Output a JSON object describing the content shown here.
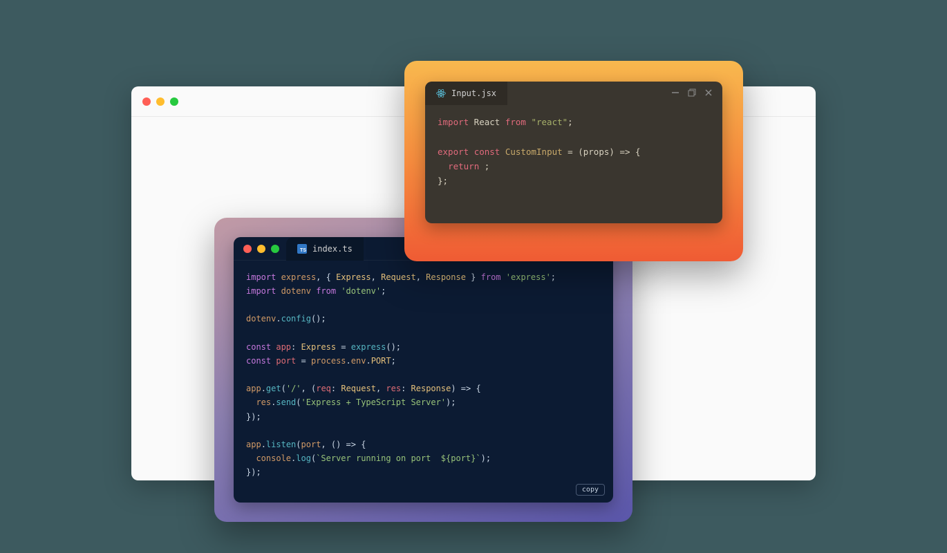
{
  "editor1": {
    "filename": "Input.jsx",
    "code_tokens": [
      [
        [
          "d1-kw",
          "import"
        ],
        [
          "d1-id",
          " React "
        ],
        [
          "d1-kw",
          "from"
        ],
        [
          "d1-id",
          " "
        ],
        [
          "d1-str",
          "\"react\""
        ],
        [
          "d1-id",
          ";"
        ]
      ],
      [],
      [
        [
          "d1-kw",
          "export"
        ],
        [
          "d1-id",
          " "
        ],
        [
          "d1-kw",
          "const"
        ],
        [
          "d1-id",
          " "
        ],
        [
          "d1-decl",
          "CustomInput"
        ],
        [
          "d1-id",
          " = (props) =&gt; {"
        ]
      ],
      [
        [
          "d1-id",
          "  "
        ],
        [
          "d1-kw",
          "return"
        ],
        [
          "d1-id",
          " ;"
        ]
      ],
      [
        [
          "d1-id",
          "};"
        ]
      ]
    ]
  },
  "editor2": {
    "filename": "index.ts",
    "copy_label": "copy",
    "code_tokens": [
      [
        [
          "d2-kw",
          "import"
        ],
        [
          "d2-plain",
          " "
        ],
        [
          "d2-id",
          "express"
        ],
        [
          "d2-plain",
          ", { "
        ],
        [
          "d2-type",
          "Express"
        ],
        [
          "d2-plain",
          ", "
        ],
        [
          "d2-type",
          "Request"
        ],
        [
          "d2-plain",
          ", "
        ],
        [
          "d2-type",
          "Response"
        ],
        [
          "d2-plain",
          " } "
        ],
        [
          "d2-kw",
          "from"
        ],
        [
          "d2-plain",
          " "
        ],
        [
          "d2-str",
          "'express'"
        ],
        [
          "d2-plain",
          ";"
        ]
      ],
      [
        [
          "d2-kw",
          "import"
        ],
        [
          "d2-plain",
          " "
        ],
        [
          "d2-id",
          "dotenv"
        ],
        [
          "d2-plain",
          " "
        ],
        [
          "d2-kw",
          "from"
        ],
        [
          "d2-plain",
          " "
        ],
        [
          "d2-str",
          "'dotenv'"
        ],
        [
          "d2-plain",
          ";"
        ]
      ],
      [],
      [
        [
          "d2-id",
          "dotenv"
        ],
        [
          "d2-plain",
          "."
        ],
        [
          "d2-fn",
          "config"
        ],
        [
          "d2-plain",
          "();"
        ]
      ],
      [],
      [
        [
          "d2-kw",
          "const"
        ],
        [
          "d2-plain",
          " "
        ],
        [
          "d2-prop",
          "app"
        ],
        [
          "d2-plain",
          ": "
        ],
        [
          "d2-type",
          "Express"
        ],
        [
          "d2-plain",
          " = "
        ],
        [
          "d2-fn",
          "express"
        ],
        [
          "d2-plain",
          "();"
        ]
      ],
      [
        [
          "d2-kw",
          "const"
        ],
        [
          "d2-plain",
          " "
        ],
        [
          "d2-prop",
          "port"
        ],
        [
          "d2-plain",
          " = "
        ],
        [
          "d2-id",
          "process"
        ],
        [
          "d2-plain",
          "."
        ],
        [
          "d2-id",
          "env"
        ],
        [
          "d2-plain",
          "."
        ],
        [
          "d2-type",
          "PORT"
        ],
        [
          "d2-plain",
          ";"
        ]
      ],
      [],
      [
        [
          "d2-id",
          "app"
        ],
        [
          "d2-plain",
          "."
        ],
        [
          "d2-fn",
          "get"
        ],
        [
          "d2-plain",
          "("
        ],
        [
          "d2-str",
          "'/'"
        ],
        [
          "d2-plain",
          ", ("
        ],
        [
          "d2-prop",
          "req"
        ],
        [
          "d2-plain",
          ": "
        ],
        [
          "d2-type",
          "Request"
        ],
        [
          "d2-plain",
          ", "
        ],
        [
          "d2-prop",
          "res"
        ],
        [
          "d2-plain",
          ": "
        ],
        [
          "d2-type",
          "Response"
        ],
        [
          "d2-plain",
          ") =&gt; {"
        ]
      ],
      [
        [
          "d2-plain",
          "  "
        ],
        [
          "d2-id",
          "res"
        ],
        [
          "d2-plain",
          "."
        ],
        [
          "d2-fn",
          "send"
        ],
        [
          "d2-plain",
          "("
        ],
        [
          "d2-str",
          "'Express + TypeScript Server'"
        ],
        [
          "d2-plain",
          ");"
        ]
      ],
      [
        [
          "d2-plain",
          "});"
        ]
      ],
      [],
      [
        [
          "d2-id",
          "app"
        ],
        [
          "d2-plain",
          "."
        ],
        [
          "d2-fn",
          "listen"
        ],
        [
          "d2-plain",
          "("
        ],
        [
          "d2-id",
          "port"
        ],
        [
          "d2-plain",
          ", () =&gt; {"
        ]
      ],
      [
        [
          "d2-plain",
          "  "
        ],
        [
          "d2-id",
          "console"
        ],
        [
          "d2-plain",
          "."
        ],
        [
          "d2-fn",
          "log"
        ],
        [
          "d2-plain",
          "("
        ],
        [
          "d2-str",
          "`Server running on port  ${port}`"
        ],
        [
          "d2-plain",
          ");"
        ]
      ],
      [
        [
          "d2-plain",
          "});"
        ]
      ]
    ]
  }
}
